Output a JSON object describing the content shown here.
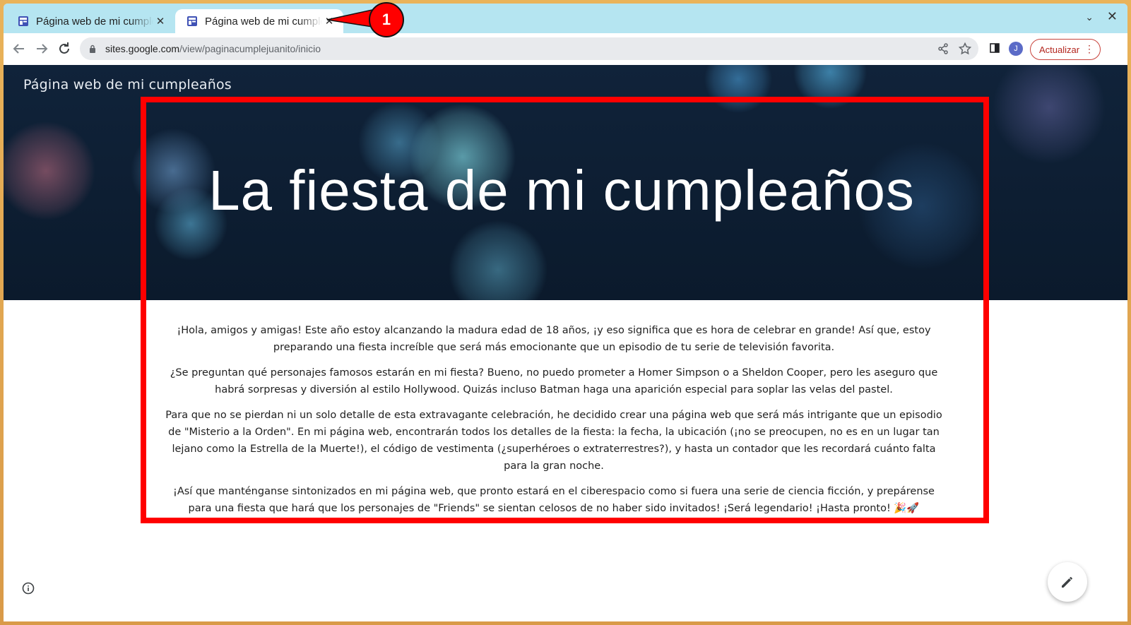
{
  "browser": {
    "tabs": [
      {
        "title": "Página web de mi cumpleaños",
        "active": false
      },
      {
        "title": "Página web de mi cumpleaños",
        "active": true
      }
    ],
    "tab_close_glyph": "✕",
    "tab_dropdown_glyph": "⌄",
    "window_close_glyph": "✕",
    "url_host": "sites.google.com",
    "url_path": "/view/paginacumplejuanito/inicio",
    "profile_initial": "J",
    "update_label": "Actualizar",
    "accent_color": "#b3261e"
  },
  "site": {
    "header_title": "Página web de mi cumpleaños",
    "hero_heading": "La fiesta de mi cumpleaños",
    "paragraphs": [
      "¡Hola, amigos y amigas! Este año estoy alcanzando la madura edad de 18 años, ¡y eso significa que es hora de celebrar en grande! Así que, estoy preparando una fiesta increíble que será más emocionante que un episodio de tu serie de televisión favorita.",
      "¿Se preguntan qué personajes famosos estarán en mi fiesta? Bueno, no puedo prometer a Homer Simpson o a Sheldon Cooper, pero les aseguro que habrá sorpresas y diversión al estilo Hollywood. Quizás incluso Batman haga una aparición especial para soplar las velas del pastel.",
      "Para que no se pierdan ni un solo detalle de esta extravagante celebración, he decidido crear una página web que será más intrigante que un episodio de \"Misterio a la Orden\". En mi página web, encontrarán todos los detalles de la fiesta: la fecha, la ubicación (¡no se preocupen, no es en un lugar tan lejano como la Estrella de la Muerte!), el código de vestimenta (¿superhéroes o extraterrestres?), y hasta un contador que les recordará cuánto falta para la gran noche.",
      "¡Así que manténganse sintonizados en mi página web, que pronto estará en el ciberespacio como si fuera una serie de ciencia ficción, y prepárense para una fiesta que hará que los personajes de \"Friends\" se sientan celosos de no haber sido invitados! ¡Será legendario! ¡Hasta pronto! 🎉🚀"
    ]
  },
  "annotation": {
    "badge_number": "1",
    "color": "#ff0000"
  }
}
